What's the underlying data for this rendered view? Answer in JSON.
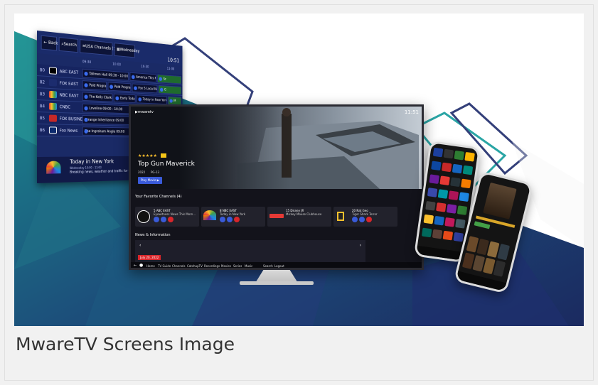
{
  "caption": "MwareTV Screens Image",
  "colors": {
    "accent_blue": "#3a5bd9",
    "bg_teal": "#1f7f8f",
    "bg_navy": "#1b2f6b",
    "red_badge": "#d9262b"
  },
  "epg": {
    "back_label": "Back",
    "search_label": "Search",
    "channels_label": "USA Channels (17)",
    "date_label": "Wednesday",
    "clock": "10:51",
    "times": [
      "09:30",
      "10:00",
      "10:30",
      "11:00"
    ],
    "rows": [
      {
        "num": "80",
        "channel": "ABC EAST",
        "programs": [
          "Tallmen Hall 09:30 - 10:00",
          "America This Mo",
          "Sc"
        ]
      },
      {
        "num": "82",
        "channel": "FOX EAST",
        "programs": [
          "Paid Program 09:3",
          "Paid Program 09:3",
          "Fox 5 Local Ne",
          "G"
        ]
      },
      {
        "num": "83",
        "channel": "NBC EAST",
        "programs": [
          "The Kelly Clarkson",
          "Early Today 09:",
          "Today in New York",
          "M"
        ]
      },
      {
        "num": "84",
        "channel": "CNBC",
        "programs": [
          "Loveline 09:00 - 10:00"
        ]
      },
      {
        "num": "85",
        "channel": "FOX BUSINESS",
        "programs": [
          "Strange Inheritance 09:00"
        ]
      },
      {
        "num": "86",
        "channel": "Fox News",
        "programs": [
          "The Ingraham Angle 09:00"
        ]
      }
    ],
    "info": {
      "title": "Today in New York",
      "time": "Wednesday 10:00 - 11:00",
      "desc": "Breaking news, weather and traffic for the minute you're up with the Today"
    }
  },
  "tv": {
    "brand": "mwaretv",
    "clock": "11:51",
    "stars": "★★★★★",
    "title": "Top Gun Maverick",
    "year": "2022",
    "rating": "PG-13",
    "play_label": "Play Movie",
    "favorites_label": "Your Favorite Channels (4)",
    "channels": [
      {
        "name": "5 ABC EAST",
        "program": "Eyewitness News This Morn..."
      },
      {
        "name": "8 NBC EAST",
        "program": "Today in New York"
      },
      {
        "name": "15 Disney JR",
        "program": "Mickey Mouse Clubhouse"
      },
      {
        "name": "20 Nat Geo",
        "program": "Tiger Shark Terror"
      }
    ],
    "news_label": "News & Information",
    "date_badge": "July 20, 2022",
    "menu": [
      "Home",
      "TV Guide",
      "Channels",
      "CatchupTV",
      "Recordings",
      "Movies",
      "Series",
      "Music",
      "Search",
      "Logout"
    ]
  },
  "phone_big": {
    "tiles": [
      "#1c3f9e",
      "#333333",
      "#2e7d32",
      "#ffb300",
      "#0d47a1",
      "#c62828",
      "#1565c0",
      "#00897b",
      "#6a1b9a",
      "#e53935",
      "#263238",
      "#f57c00",
      "#3949ab",
      "#0097a7",
      "#ad1457",
      "#1e88e5",
      "#424242",
      "#d32f2f",
      "#7b1fa2",
      "#2e7d32",
      "#fbc02d",
      "#1565c0",
      "#c2185b",
      "#455a64",
      "#00695c",
      "#5d4037",
      "#e64a19",
      "#303f9f"
    ]
  },
  "phone_small": {
    "posters": [
      "#6b4a2a",
      "#3b2a1d",
      "#8c6b3c",
      "#2f3b45",
      "#4a2f1d",
      "#5b4632",
      "#7a5a30",
      "#2c2c2c"
    ]
  }
}
